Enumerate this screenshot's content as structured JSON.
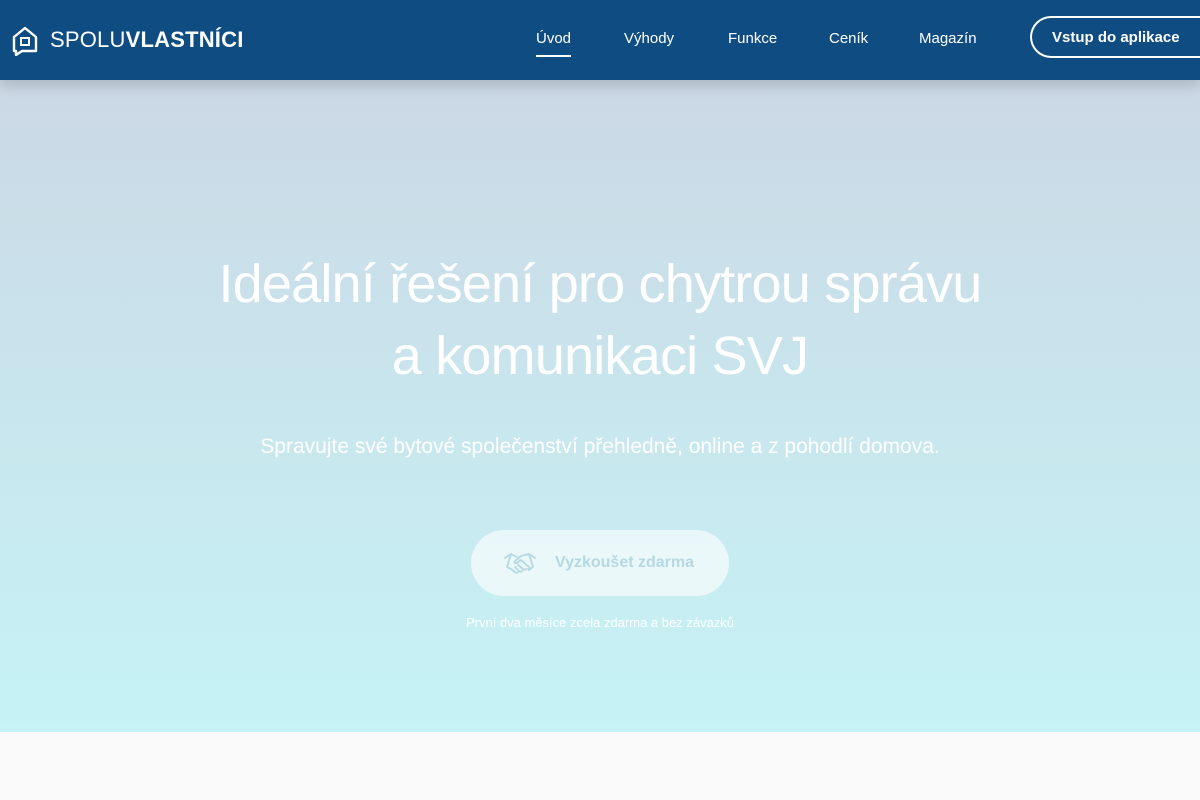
{
  "header": {
    "logo": {
      "light": "SPOLU",
      "bold": "VLASTNÍCI",
      "icon": "house-chat-icon"
    },
    "nav": [
      {
        "label": "Úvod",
        "active": true
      },
      {
        "label": "Výhody",
        "active": false
      },
      {
        "label": "Funkce",
        "active": false
      },
      {
        "label": "Ceník",
        "active": false
      },
      {
        "label": "Magazín",
        "active": false
      }
    ],
    "app_button": "Vstup do aplikace"
  },
  "hero": {
    "title_line1": "Ideální řešení pro chytrou správu",
    "title_line2": "a komunikaci SVJ",
    "subtitle": "Spravujte své bytové společenství přehledně, online a z pohodlí domova.",
    "cta": {
      "label": "Vyzkoušet zdarma",
      "icon": "handshake-icon"
    },
    "note": "První dva měsíce zcela zdarma a bez závazků"
  },
  "colors": {
    "header_bg": "#0f4c81",
    "hero_top": "#cbd8e5",
    "hero_bottom": "#c6f3f6",
    "cta_text": "#b6d8e2"
  }
}
